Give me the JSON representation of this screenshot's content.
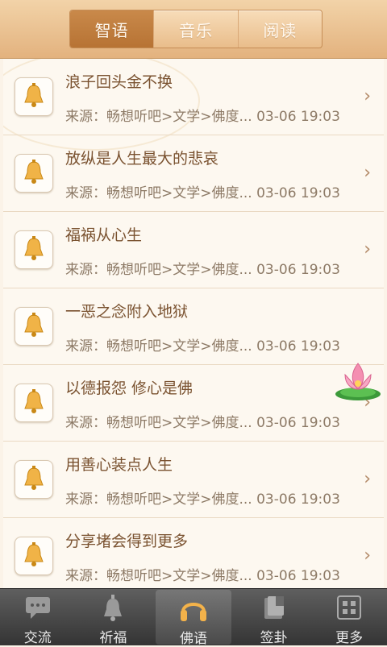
{
  "tabs": [
    {
      "label": "智语",
      "active": true
    },
    {
      "label": "音乐",
      "active": false
    },
    {
      "label": "阅读",
      "active": false
    }
  ],
  "items": [
    {
      "title": "浪子回头金不换",
      "source": "来源：畅想听吧>文学>佛度...",
      "time": "03-06 19:03"
    },
    {
      "title": "放纵是人生最大的悲哀",
      "source": "来源：畅想听吧>文学>佛度...",
      "time": "03-06 19:03"
    },
    {
      "title": "福祸从心生",
      "source": "来源：畅想听吧>文学>佛度...",
      "time": "03-06 19:03"
    },
    {
      "title": "一恶之念附入地狱",
      "source": "来源：畅想听吧>文学>佛度...",
      "time": "03-06 19:03"
    },
    {
      "title": "以德报怨 修心是佛",
      "source": "来源：畅想听吧>文学>佛度...",
      "time": "03-06 19:03"
    },
    {
      "title": "用善心装点人生",
      "source": "来源：畅想听吧>文学>佛度...",
      "time": "03-06 19:03"
    },
    {
      "title": "分享堵会得到更多",
      "source": "来源：畅想听吧>文学>佛度...",
      "time": "03-06 19:03"
    }
  ],
  "bottom_nav": [
    {
      "label": "交流",
      "icon": "chat-icon"
    },
    {
      "label": "祈福",
      "icon": "bell-icon"
    },
    {
      "label": "佛语",
      "icon": "headphones-icon",
      "active": true
    },
    {
      "label": "签卦",
      "icon": "cards-icon"
    },
    {
      "label": "更多",
      "icon": "grid-icon"
    }
  ],
  "colors": {
    "accent": "#b77334",
    "title": "#7a5230",
    "meta": "#8d7a66"
  }
}
